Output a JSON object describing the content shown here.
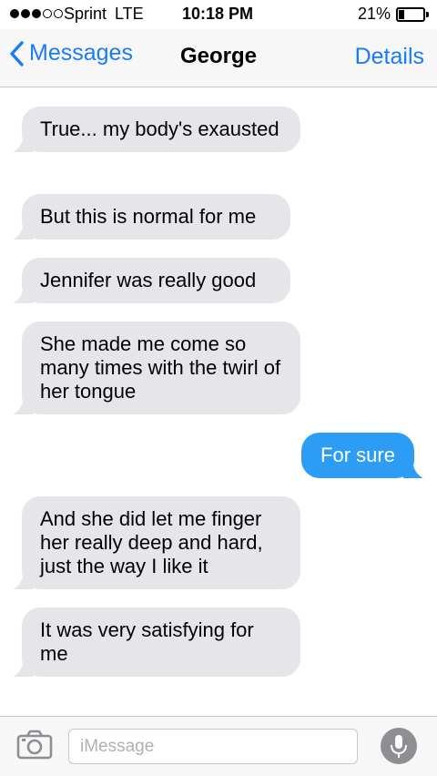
{
  "status_bar": {
    "carrier": "Sprint",
    "network": "LTE",
    "time": "10:18 PM",
    "battery_percent": "21%",
    "battery_level": 0.21,
    "signal_bars_filled": 3,
    "signal_bars_total": 5
  },
  "nav": {
    "back_label": "Messages",
    "title": "George",
    "details_label": "Details"
  },
  "messages": [
    {
      "direction": "incoming",
      "text": "True... my body's exausted"
    },
    {
      "direction": "incoming",
      "text": "But this is normal for me"
    },
    {
      "direction": "incoming",
      "text": "Jennifer was really good"
    },
    {
      "direction": "incoming",
      "text": "She made me come so many times with the twirl of her tongue"
    },
    {
      "direction": "outgoing",
      "text": "For sure"
    },
    {
      "direction": "incoming",
      "text": "And she did let me finger her really deep and hard, just the way I like it"
    },
    {
      "direction": "incoming",
      "text": "It was very satisfying for me"
    }
  ],
  "input_bar": {
    "placeholder": "iMessage",
    "camera_icon": "camera-icon",
    "mic_icon": "microphone-icon"
  },
  "colors": {
    "accent": "#1a7cf5",
    "incoming_bubble": "#e5e5ea",
    "outgoing_bubble": "#2d9cf4"
  }
}
